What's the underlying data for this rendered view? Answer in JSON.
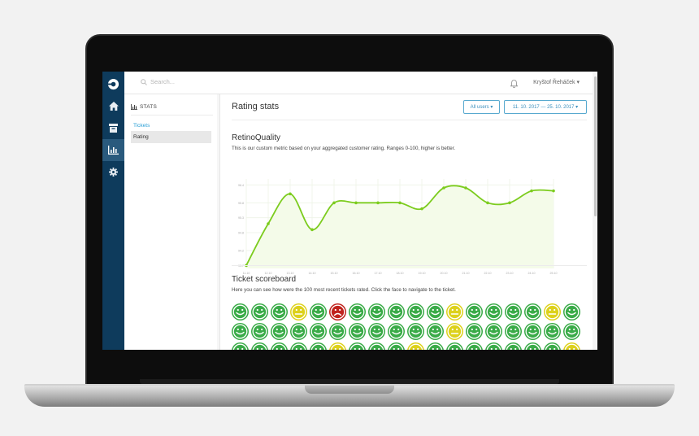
{
  "topbar": {
    "search_placeholder": "Search...",
    "user_name": "Kryštof Řeháček ▾"
  },
  "rail": {
    "icons": [
      "logo-icon",
      "home-icon",
      "archive-icon",
      "stats-icon",
      "gear-icon"
    ]
  },
  "sidebar": {
    "heading": "STATS",
    "items": [
      {
        "label": "Tickets",
        "state": "link"
      },
      {
        "label": "Rating",
        "state": "selected"
      }
    ]
  },
  "main": {
    "title": "Rating stats",
    "users_filter": "All users ▾",
    "date_range": "11. 10. 2017 — 25. 10. 2017 ▾",
    "retino": {
      "title": "RetinoQuality",
      "description": "This is our custom metric based on your aggregated customer rating. Ranges 0-100, higher is better."
    },
    "scoreboard": {
      "title": "Ticket scoreboard",
      "description": "Here you can see how were the 100 most recent tickets rated. Click the face to navigate to the ticket.",
      "rows": [
        [
          "good",
          "good",
          "good",
          "neutral",
          "good",
          "bad",
          "good",
          "good",
          "good",
          "good",
          "good",
          "neutral",
          "good",
          "good",
          "good",
          "good",
          "neutral",
          "good"
        ],
        [
          "good",
          "good",
          "good",
          "good",
          "good",
          "good",
          "good",
          "good",
          "good",
          "good",
          "good",
          "neutral",
          "good",
          "good",
          "good",
          "good",
          "good",
          "good"
        ],
        [
          "good",
          "good",
          "good",
          "good",
          "good",
          "neutral",
          "good",
          "good",
          "good",
          "neutral",
          "good",
          "good",
          "good",
          "good",
          "good",
          "good",
          "good",
          "neutral"
        ]
      ]
    }
  },
  "colors": {
    "rail": "#0e3b5c",
    "accent": "#2a9fd6",
    "line": "#7ccc1e",
    "good": "#3aab48",
    "neutral": "#ddd11b",
    "bad": "#c0231e"
  },
  "chart_data": {
    "type": "line",
    "x": [
      "11.10",
      "12.10",
      "13.10",
      "14.10",
      "15.10",
      "16.10",
      "17.10",
      "18.10",
      "19.10",
      "20.10",
      "21.10",
      "22.10",
      "23.10",
      "24.10",
      "25.10"
    ],
    "y": [
      93.7,
      95.1,
      96.1,
      94.9,
      95.8,
      95.8,
      95.8,
      95.8,
      95.6,
      96.3,
      96.3,
      95.8,
      95.8,
      96.2,
      96.2
    ],
    "yticks": [
      93.7,
      94.2,
      94.8,
      95.3,
      95.8,
      96.4
    ],
    "ylim": [
      93.6,
      96.6
    ],
    "grid": true
  }
}
